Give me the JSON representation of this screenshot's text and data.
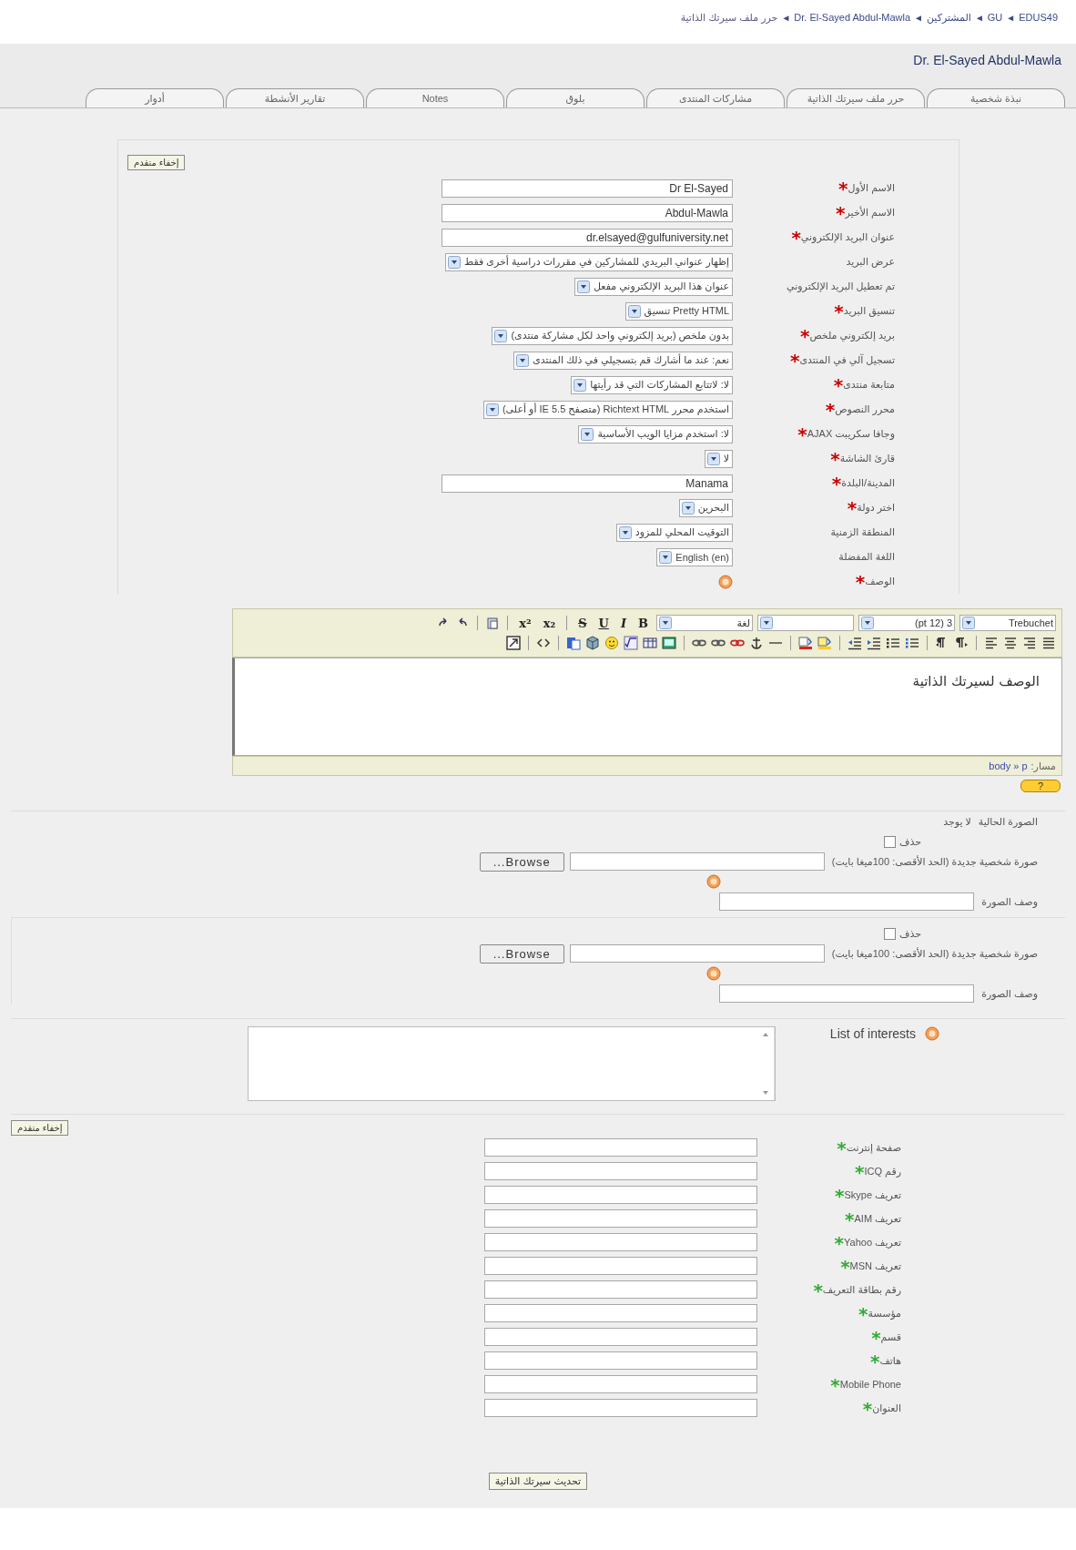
{
  "breadcrumb": [
    {
      "kind": "link",
      "label": "EDUS49"
    },
    {
      "kind": "separator",
      "label": "◄"
    },
    {
      "kind": "link",
      "label": "GU"
    },
    {
      "kind": "separator",
      "label": "◄"
    },
    {
      "kind": "link",
      "label": "المشتركين"
    },
    {
      "kind": "separator",
      "label": "◄"
    },
    {
      "kind": "link",
      "label": "Dr. El-Sayed Abdul-Mawla"
    },
    {
      "kind": "separator",
      "label": "◄"
    },
    {
      "kind": "current",
      "label": "حرر ملف سيرتك الذاتية"
    }
  ],
  "title": "Dr. El-Sayed Abdul-Mawla",
  "tabs": [
    {
      "label": "نبذة شخصية"
    },
    {
      "label": "حرر ملف سيرتك الذاتية"
    },
    {
      "label": "مشاركات المنتدى"
    },
    {
      "label": "بلوق"
    },
    {
      "label": "Notes"
    },
    {
      "label": "تقارير الأنشطة"
    },
    {
      "label": "أدوار"
    }
  ],
  "panels": [
    {
      "kind": "main",
      "toggle": "إخفاء متقدم",
      "groups": [
        {
          "rows": [
            {
              "kind": "text",
              "label": "الاسم الأول",
              "marker": {
                "text": "*",
                "color": "#cc0000"
              },
              "value": "Dr El-Sayed"
            },
            {
              "kind": "text",
              "label": "الاسم الأخير",
              "marker": {
                "text": "*",
                "color": "#cc0000"
              },
              "value": "Abdul-Mawla"
            },
            {
              "kind": "text",
              "label": "عنوان البريد الإلكتروني",
              "marker": {
                "text": "*",
                "color": "#cc0000"
              },
              "value": "dr.elsayed@gulfuniversity.net"
            },
            {
              "kind": "select",
              "label": "عرض البريد",
              "value": "إظهار عنواني البريدي للمشاركين في مقررات دراسية أخرى فقط"
            },
            {
              "kind": "select",
              "label": "تم تعطيل البريد الإلكتروني",
              "value": "عنوان هذا البريد الإلكتروني مفعل"
            },
            {
              "kind": "select",
              "label": "تنسيق البريد",
              "marker": {
                "text": "*",
                "color": "#cc0000"
              },
              "value": "Pretty HTML تنسيق"
            },
            {
              "kind": "select",
              "label": "بريد إلكتروني ملخص",
              "marker": {
                "text": "*",
                "color": "#cc0000"
              },
              "value": "بدون ملخص (بريد إلكتروني واحد لكل مشاركة منتدى)"
            },
            {
              "kind": "select",
              "label": "تسجيل آلي في المنتدى",
              "marker": {
                "text": "*",
                "color": "#cc0000"
              },
              "value": "نعم: عند ما أشارك قم بتسجيلي في ذلك المنتدى"
            },
            {
              "kind": "select",
              "label": "متابعة منتدى",
              "marker": {
                "text": "*",
                "color": "#cc0000"
              },
              "value": "لا: لاتتابع المشاركات التي قد رأيتها"
            },
            {
              "kind": "select",
              "label": "محرر النصوص",
              "marker": {
                "text": "*",
                "color": "#cc0000"
              },
              "value": "استخدم محرر Richtext HTML (متصفح IE 5.5 أو أعلى)"
            },
            {
              "kind": "select",
              "label": "AJAX وجافا سكريبت",
              "marker": {
                "text": "*",
                "color": "#cc0000"
              },
              "value": "لا: استخدم مزايا الويب الأساسية"
            },
            {
              "kind": "select",
              "label": "قارئ الشاشة",
              "marker": {
                "text": "*",
                "color": "#cc0000"
              },
              "value": "لا"
            },
            {
              "kind": "text",
              "label": "المدينة/البلدة",
              "marker": {
                "text": "*",
                "color": "#cc0000"
              },
              "value": "Manama"
            },
            {
              "kind": "select",
              "label": "اختر دولة",
              "marker": {
                "text": "*",
                "color": "#cc0000"
              },
              "value": "البحرين"
            },
            {
              "kind": "select",
              "label": "المنطقة الزمنية",
              "value": "التوقيت المحلي للمزود"
            },
            {
              "kind": "select",
              "label": "اللغة المفضلة",
              "value": "English (en)"
            },
            {
              "kind": "help",
              "label": "الوصف",
              "marker": {
                "text": "*",
                "color": "#cc0000"
              }
            }
          ]
        }
      ],
      "editor": {
        "toolbar": [
          {
            "kind": "select",
            "value": "Trebuchet"
          },
          {
            "kind": "select",
            "value": "3 (pt 12)"
          },
          {
            "kind": "select"
          },
          {
            "kind": "select",
            "value": "لغة"
          },
          {
            "kind": "button",
            "label": "B"
          },
          {
            "kind": "button",
            "label": "I"
          },
          {
            "kind": "button",
            "label": "U"
          },
          {
            "kind": "button",
            "label": "S"
          },
          {
            "kind": "separator"
          },
          {
            "kind": "button",
            "label": "x₂"
          },
          {
            "kind": "button",
            "label": "x²"
          },
          {
            "kind": "separator"
          }
        ],
        "content": "الوصف لسيرتك الذاتية",
        "path_label": "مسار:",
        "path": "body » p",
        "help_button": "?"
      }
    },
    {
      "kind": "picture",
      "groups": [
        {
          "rows": [
            {
              "kind": "static",
              "label": "الصورة الحالية",
              "value": "لا يوجد"
            },
            {
              "kind": "checkbox",
              "label": "حذف",
              "checked": false
            },
            {
              "kind": "file",
              "label": "صورة شخصية جديدة (الحد الأقصى: 100ميغا بايت)",
              "button": "Browse..."
            },
            {
              "kind": "help"
            },
            {
              "kind": "text",
              "label": "وصف الصورة"
            }
          ]
        },
        {
          "rows": [
            {
              "kind": "checkbox",
              "label": "حذف",
              "checked": false
            },
            {
              "kind": "file",
              "label": "صورة شخصية جديدة (الحد الأقصى: 100ميغا بايت)",
              "button": "Browse..."
            },
            {
              "kind": "help"
            },
            {
              "kind": "text",
              "label": "وصف الصورة"
            }
          ]
        }
      ]
    },
    {
      "kind": "interests",
      "groups": [
        {
          "rows": [
            {
              "kind": "textarea",
              "label": "List of interests"
            }
          ]
        }
      ]
    },
    {
      "kind": "optional",
      "toggle": "إخفاء متقدم",
      "groups": [
        {
          "rows": [
            {
              "kind": "text",
              "label": "صفحة إنترنت",
              "marker": {
                "text": "*",
                "color": "#33aa33"
              }
            },
            {
              "kind": "text",
              "label": "ICQ رقم",
              "marker": {
                "text": "*",
                "color": "#33aa33"
              }
            },
            {
              "kind": "text",
              "label": "Skype تعريف",
              "marker": {
                "text": "*",
                "color": "#33aa33"
              }
            },
            {
              "kind": "text",
              "label": "AIM تعريف",
              "marker": {
                "text": "*",
                "color": "#33aa33"
              }
            },
            {
              "kind": "text",
              "label": "Yahoo تعريف",
              "marker": {
                "text": "*",
                "color": "#33aa33"
              }
            },
            {
              "kind": "text",
              "label": "MSN تعريف",
              "marker": {
                "text": "*",
                "color": "#33aa33"
              }
            },
            {
              "kind": "text",
              "label": "رقم بطاقة التعريف",
              "marker": {
                "text": "*",
                "color": "#33aa33"
              }
            },
            {
              "kind": "text",
              "label": "مؤسسة",
              "marker": {
                "text": "*",
                "color": "#33aa33"
              }
            },
            {
              "kind": "text",
              "label": "قسم",
              "marker": {
                "text": "*",
                "color": "#33aa33"
              }
            },
            {
              "kind": "text",
              "label": "هاتف",
              "marker": {
                "text": "*",
                "color": "#33aa33"
              }
            },
            {
              "kind": "text",
              "label": "Mobile Phone",
              "marker": {
                "text": "*",
                "color": "#33aa33"
              }
            },
            {
              "kind": "text",
              "label": "العنوان",
              "marker": {
                "text": "*",
                "color": "#33aa33"
              }
            }
          ]
        }
      ]
    }
  ],
  "submit": "تحديث سيرتك الذاتية"
}
